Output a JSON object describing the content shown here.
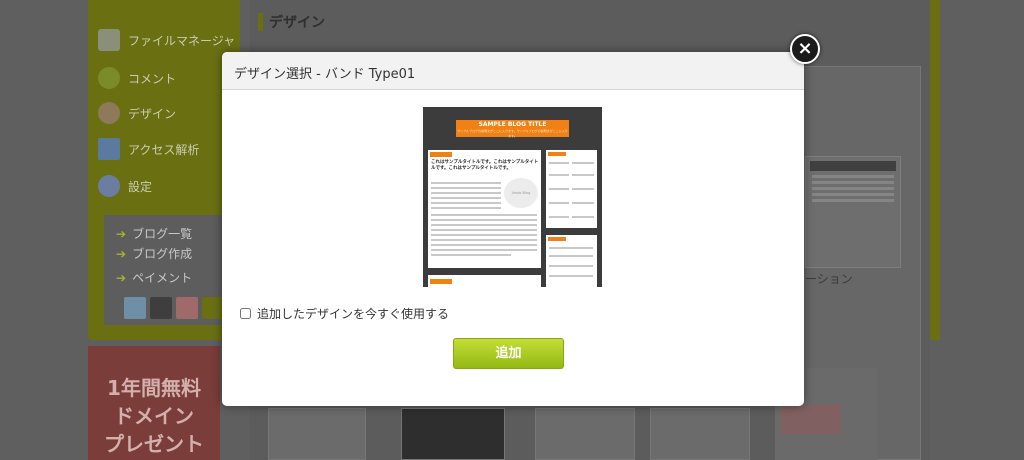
{
  "sidebar": {
    "items": [
      {
        "label": "ファイルマネージャ",
        "icon": "file-manager-icon"
      },
      {
        "label": "コメント",
        "icon": "comment-icon"
      },
      {
        "label": "デザイン",
        "icon": "design-icon"
      },
      {
        "label": "アクセス解析",
        "icon": "access-analysis-icon"
      },
      {
        "label": "設定",
        "icon": "settings-icon"
      }
    ],
    "sub_links": [
      "ブログ一覧",
      "ブログ作成",
      "ペイメント"
    ],
    "color_swatches": [
      "#6f8fa6",
      "#3e3e3e",
      "#a06a6a",
      "#6a7012"
    ]
  },
  "page": {
    "title": "デザイン",
    "bg_caption": "ーション"
  },
  "promo": {
    "small_text": "",
    "lines": [
      "1年間無料",
      "ドメイン",
      "プレゼント"
    ]
  },
  "modal": {
    "title": "デザイン選択 - バンド Type01",
    "close_label": "×",
    "preview": {
      "blog_title": "SAMPLE BLOG TITLE",
      "blog_subtitle": "サンプルブログの説明文がここに入ります。サンプルブログの説明文がここに入ります。",
      "post_title": "これはサンプルタイトルです。これはサンプルタイトルです。これはサンプルタイトルです。",
      "logo_text": "Jimdo Blog"
    },
    "checkbox_label": "追加したデザインを今すぐ使用する",
    "checkbox_checked": false,
    "add_button_label": "追加"
  },
  "colors": {
    "accent_green": "#93ba12",
    "preview_orange": "#f08114",
    "sidebar_green": "#6a7012"
  }
}
